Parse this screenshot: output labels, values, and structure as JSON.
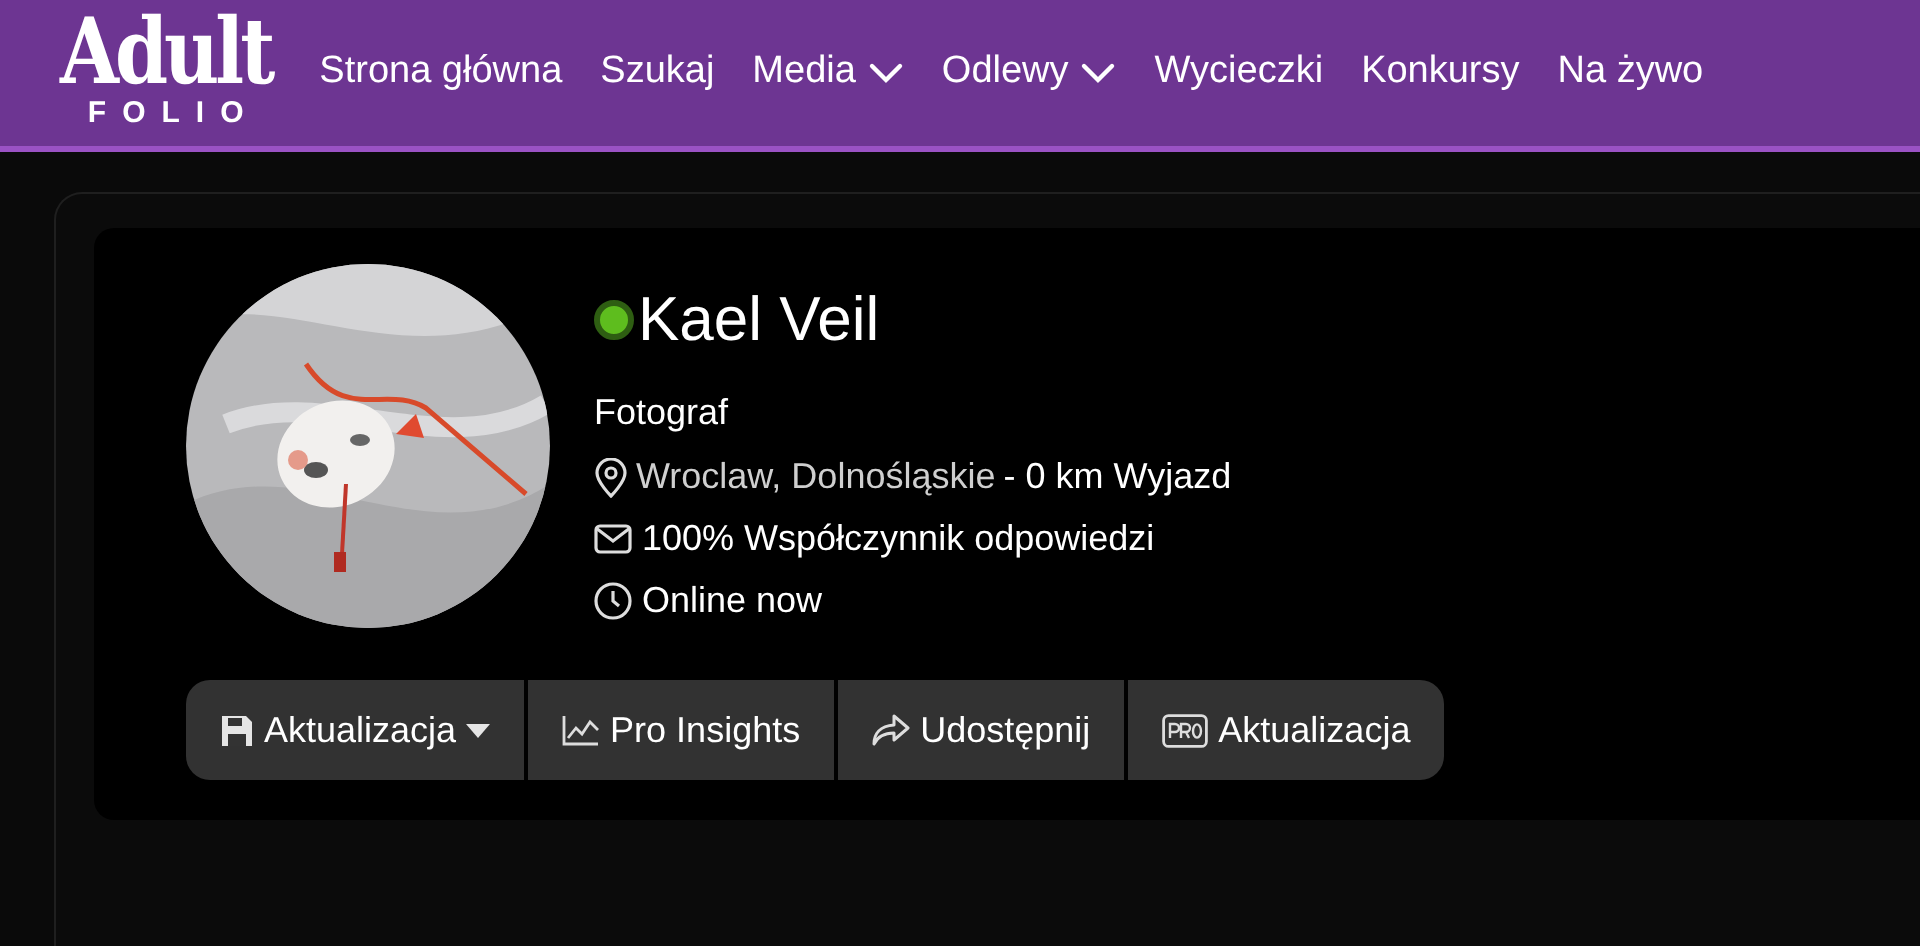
{
  "logo": {
    "title": "Adult",
    "subtitle": "FOLIO"
  },
  "nav": [
    {
      "label": "Strona główna",
      "dropdown": false
    },
    {
      "label": "Szukaj",
      "dropdown": false
    },
    {
      "label": "Media",
      "dropdown": true
    },
    {
      "label": "Odlewy",
      "dropdown": true
    },
    {
      "label": "Wycieczki",
      "dropdown": false
    },
    {
      "label": "Konkursy",
      "dropdown": false
    },
    {
      "label": "Na żywo",
      "dropdown": false
    }
  ],
  "profile": {
    "name": "Kael Veil",
    "online": true,
    "role": "Fotograf",
    "location": "Wroclaw, Dolnośląskie",
    "travel": "- 0 km Wyjazd",
    "response_rate": "100% Współczynnik odpowiedzi",
    "status": "Online now"
  },
  "actions": [
    {
      "kind": "save",
      "label": "Aktualizacja",
      "dropdown": true
    },
    {
      "kind": "chart",
      "label": "Pro Insights",
      "dropdown": false
    },
    {
      "kind": "share",
      "label": "Udostępnij",
      "dropdown": false
    },
    {
      "kind": "pro",
      "label": "Aktualizacja",
      "dropdown": false
    }
  ]
}
